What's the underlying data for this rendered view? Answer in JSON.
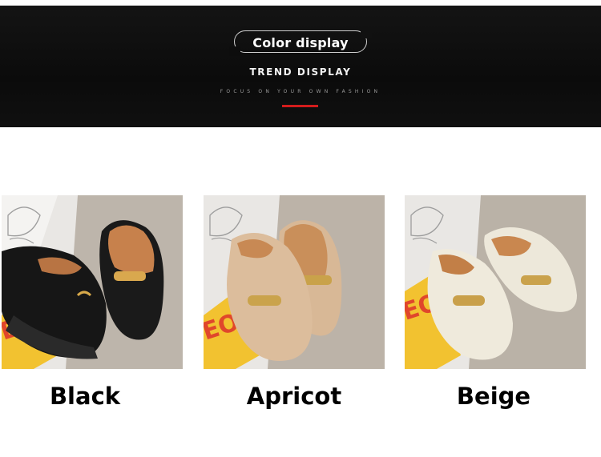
{
  "banner": {
    "heading": "Color display",
    "subheading": "TREND DISPLAY",
    "tagline": "FOCUS ON YOUR OWN FASHION"
  },
  "products": [
    {
      "label": "Black",
      "color": "#1c1c1c",
      "accent": "#d49a55"
    },
    {
      "label": "Apricot",
      "color": "#d9bb9a",
      "accent": "#c79a6f"
    },
    {
      "label": "Beige",
      "color": "#ece7d9",
      "accent": "#c98a52"
    }
  ],
  "colors": {
    "banner_bg": "#0e0e0e",
    "accent_line": "#d31c1c",
    "floor": "#b7b0a6"
  }
}
